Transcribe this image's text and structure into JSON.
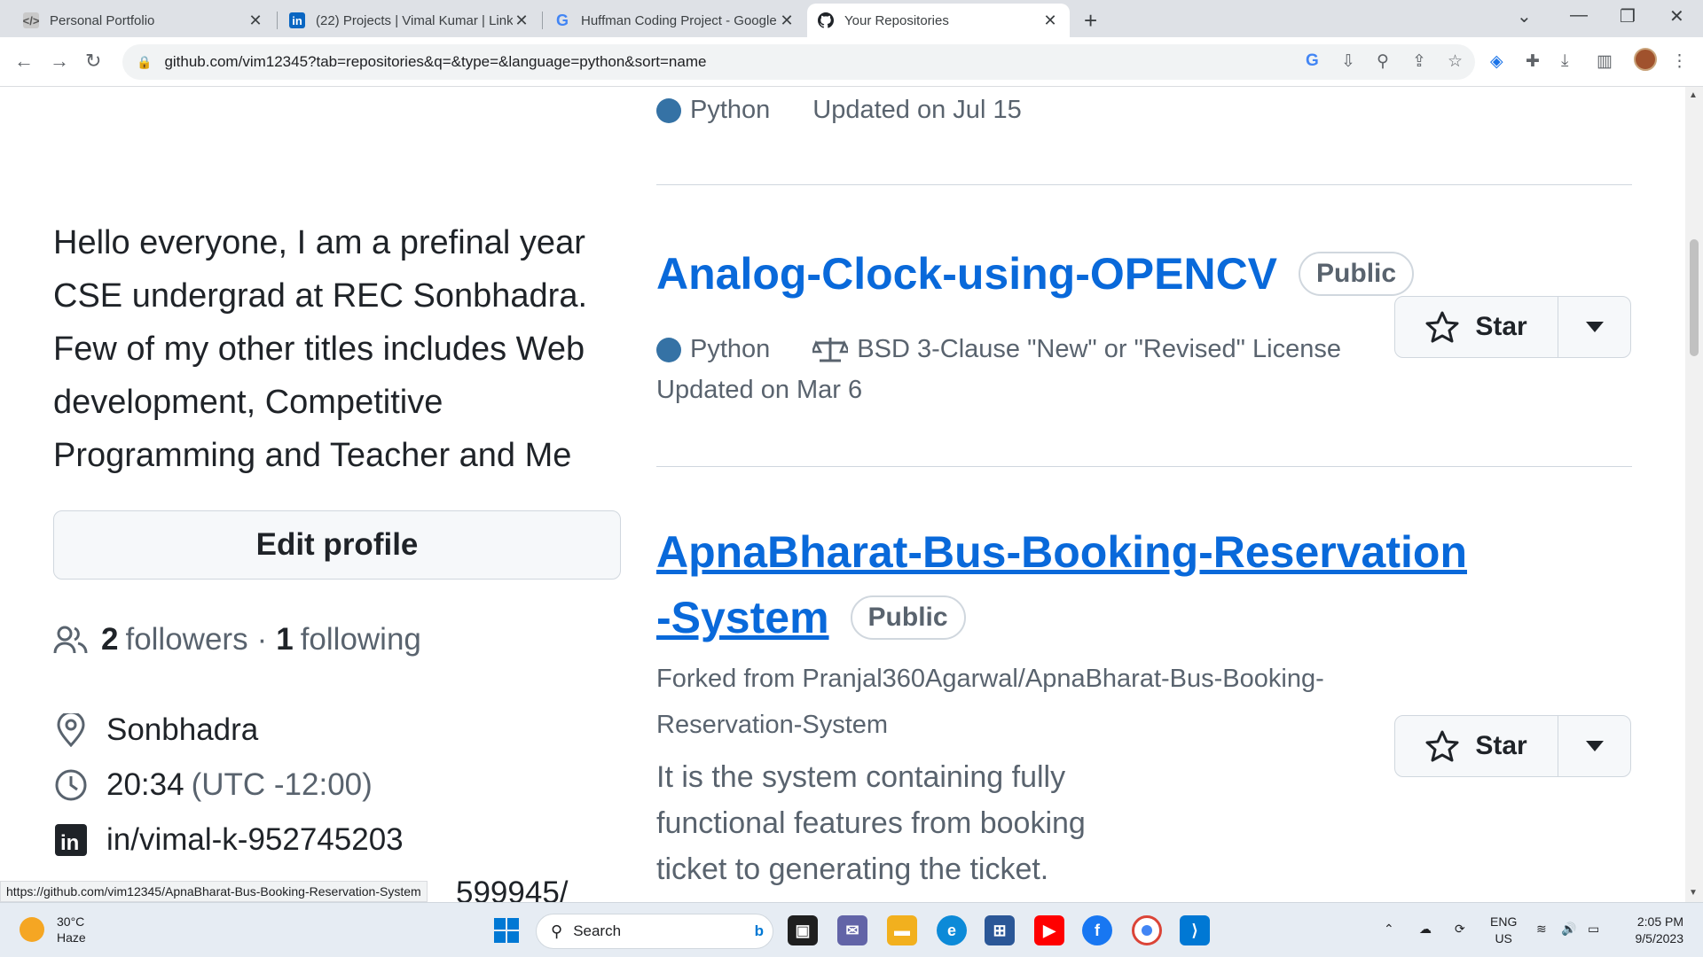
{
  "browser": {
    "tabs": [
      {
        "title": "Personal Portfolio",
        "favicon": "portfolio-icon"
      },
      {
        "title": "(22) Projects | Vimal Kumar | Link",
        "favicon": "linkedin-icon"
      },
      {
        "title": "Huffman Coding Project - Google",
        "favicon": "google-icon"
      },
      {
        "title": "Your Repositories",
        "favicon": "github-icon"
      }
    ],
    "url": "github.com/vim12345?tab=repositories&q=&type=&language=python&sort=name",
    "status_url": "https://github.com/vim12345/ApnaBharat-Bus-Booking-Reservation-System"
  },
  "profile": {
    "bio": "Hello everyone, I am a prefinal year CSE undergrad at REC Sonbhadra. Few of my other titles includes Web development, Competitive Programming and Teacher and Me",
    "edit_label": "Edit profile",
    "followers_count": "2",
    "followers_label": "followers",
    "separator": "·",
    "following_count": "1",
    "following_label": "following",
    "location": "Sonbhadra",
    "time": "20:34",
    "timezone": "(UTC -12:00)",
    "linkedin": "in/vimal-k-952745203",
    "partial_link": "599945/"
  },
  "repos": {
    "top_partial": {
      "language": "Python",
      "updated": "Updated on Jul 15"
    },
    "analog": {
      "name": "Analog-Clock-using-OPENCV",
      "visibility": "Public",
      "language": "Python",
      "license": "BSD 3-Clause \"New\" or \"Revised\" License",
      "updated": "Updated on Mar 6",
      "star_label": "Star"
    },
    "apna": {
      "name_line1": "ApnaBharat-Bus-Booking-Reservation",
      "name_line2": "-System",
      "visibility": "Public",
      "forked_line1": "Forked from Pranjal360Agarwal/ApnaBharat-Bus-Booking-",
      "forked_line2": "Reservation-System",
      "desc_line1": "It is the system containing fully",
      "desc_line2": "functional features from booking",
      "desc_line3": "ticket to generating the ticket.",
      "star_label": "Star"
    }
  },
  "taskbar": {
    "temp": "30°C",
    "weather": "Haze",
    "search_label": "Search",
    "lang1": "ENG",
    "lang2": "US",
    "clock_time": "2:05 PM",
    "clock_date": "9/5/2023"
  },
  "colors": {
    "link": "#0969da",
    "python": "#3572A5"
  }
}
